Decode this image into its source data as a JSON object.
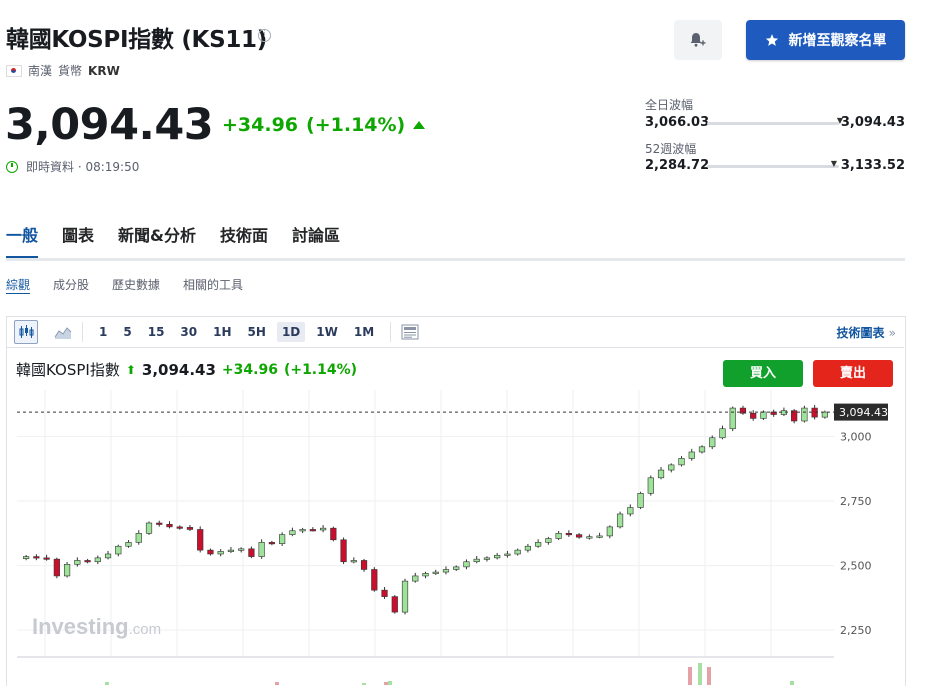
{
  "header": {
    "title": "韓國KOSPI指數 (KS11)",
    "info_glyph": "i",
    "market": "南漢",
    "currency_label": "貨幣",
    "currency": "KRW",
    "alert_button_icon": "bell-plus-icon",
    "watchlist_button": "新增至觀察名單"
  },
  "quote": {
    "price": "3,094.43",
    "change": "+34.96",
    "change_pct": "(+1.14%)",
    "status": "即時資料 · 08:19:50"
  },
  "ranges": {
    "day_label": "全日波幅",
    "day_low": "3,066.03",
    "day_high": "3,094.43",
    "week52_label": "52週波幅",
    "week52_low": "2,284.72",
    "week52_high": "3,133.52",
    "marker_glyph": "▼"
  },
  "tabs": [
    "一般",
    "圖表",
    "新聞&分析",
    "技術面",
    "討論區"
  ],
  "subtabs": [
    "綜觀",
    "成分股",
    "歷史數據",
    "相關的工具"
  ],
  "toolbar": {
    "timeframes": [
      "1",
      "5",
      "15",
      "30",
      "1H",
      "5H",
      "1D",
      "1W",
      "1M"
    ],
    "selected_timeframe": "1D",
    "advanced_link": "技術圖表",
    "advanced_arrow": "»"
  },
  "chart_header": {
    "name": "韓國KOSPI指數",
    "arrow": "⬆",
    "price": "3,094.43",
    "change": "+34.96",
    "change_pct": "(+1.14%)",
    "buy": "買入",
    "sell": "賣出",
    "watermark": "Investing",
    "watermark_suffix": ".com"
  },
  "colors": {
    "accent": "#1256a0",
    "up": "#0ea600",
    "down": "#c8102e",
    "buy": "#11a02b",
    "sell": "#e3251c",
    "watchlist": "#1f5bbf"
  },
  "chart_data": {
    "type": "candlestick",
    "ylim": [
      2150,
      3180
    ],
    "y_ticks": [
      3000,
      2750,
      2500,
      2250
    ],
    "y_tick_labels": [
      "3,000",
      "2,750",
      "2,500",
      "2,250"
    ],
    "last_price": 3094.43,
    "last_price_label": "3,094.43",
    "grid": true,
    "closes": [
      2535,
      2530,
      2525,
      2460,
      2505,
      2520,
      2515,
      2530,
      2545,
      2575,
      2590,
      2625,
      2665,
      2660,
      2650,
      2648,
      2640,
      2560,
      2545,
      2555,
      2560,
      2565,
      2535,
      2590,
      2585,
      2620,
      2635,
      2640,
      2638,
      2645,
      2600,
      2515,
      2520,
      2485,
      2405,
      2380,
      2320,
      2440,
      2460,
      2470,
      2475,
      2485,
      2495,
      2515,
      2525,
      2530,
      2540,
      2545,
      2560,
      2575,
      2590,
      2605,
      2625,
      2620,
      2610,
      2612,
      2615,
      2650,
      2700,
      2725,
      2780,
      2840,
      2870,
      2890,
      2915,
      2940,
      2960,
      2995,
      3030,
      3110,
      3090,
      3070,
      3095,
      3085,
      3100,
      3060,
      3110,
      3075,
      3094.43
    ],
    "volume_note": "volume bars partially visible at bottom"
  }
}
